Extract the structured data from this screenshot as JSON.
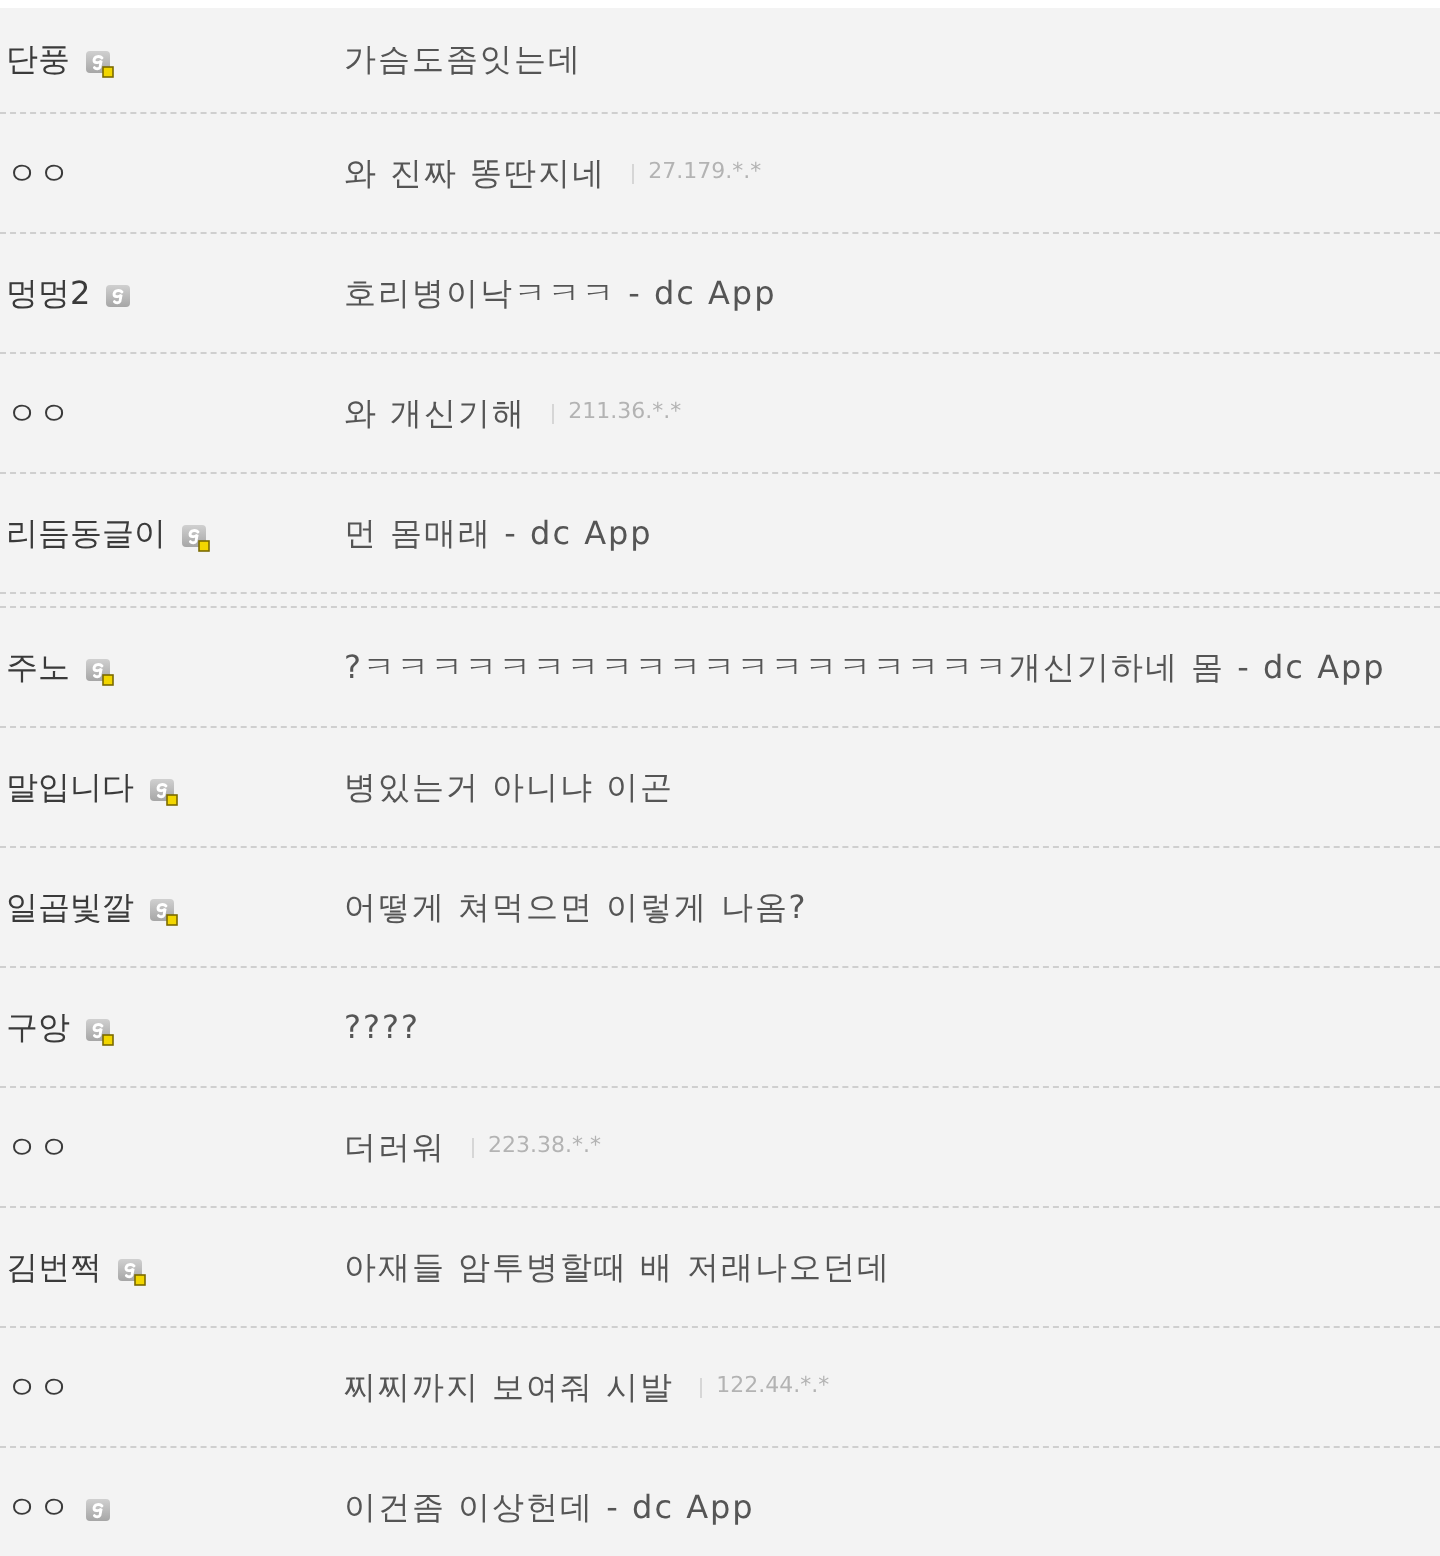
{
  "comment_groups": [
    {
      "comments": [
        {
          "nickname": "단풍",
          "badge": {
            "fixed": true
          },
          "text": "가슴도좀잇는데"
        },
        {
          "nickname": "ㅇㅇ",
          "text": "와 진짜 똥딴지네",
          "ip": "27.179.*.*"
        },
        {
          "nickname": "멍멍2",
          "badge": {
            "fixed": false
          },
          "text": "호리병이낙ㅋㅋㅋ - dc App"
        },
        {
          "nickname": "ㅇㅇ",
          "text": "와 개신기해",
          "ip": "211.36.*.*"
        },
        {
          "nickname": "리듬동글이",
          "badge": {
            "fixed": true
          },
          "text": "먼 몸매래 - dc App"
        }
      ]
    },
    {
      "comments": [
        {
          "nickname": "주노",
          "badge": {
            "fixed": true
          },
          "text": "?ㅋㅋㅋㅋㅋㅋㅋㅋㅋㅋㅋㅋㅋㅋㅋㅋㅋㅋㅋ개신기하네 몸 - dc App"
        },
        {
          "nickname": "말입니다",
          "badge": {
            "fixed": true
          },
          "text": "병있는거 아니냐 이곤"
        },
        {
          "nickname": "일곱빛깔",
          "badge": {
            "fixed": true
          },
          "text": "어떻게 쳐먹으면 이렇게 나옴?"
        },
        {
          "nickname": "구앙",
          "badge": {
            "fixed": true
          },
          "text": "????"
        },
        {
          "nickname": "ㅇㅇ",
          "text": "더러워",
          "ip": "223.38.*.*"
        },
        {
          "nickname": "김번쩍",
          "badge": {
            "fixed": true
          },
          "text": "아재들 암투병할때 배 저래나오던데"
        },
        {
          "nickname": "ㅇㅇ",
          "text": "찌찌까지 보여줘 시발",
          "ip": "122.44.*.*"
        },
        {
          "nickname": "ㅇㅇ",
          "badge": {
            "fixed": false
          },
          "text": "이건좀 이상헌데 - dc App"
        }
      ]
    }
  ]
}
